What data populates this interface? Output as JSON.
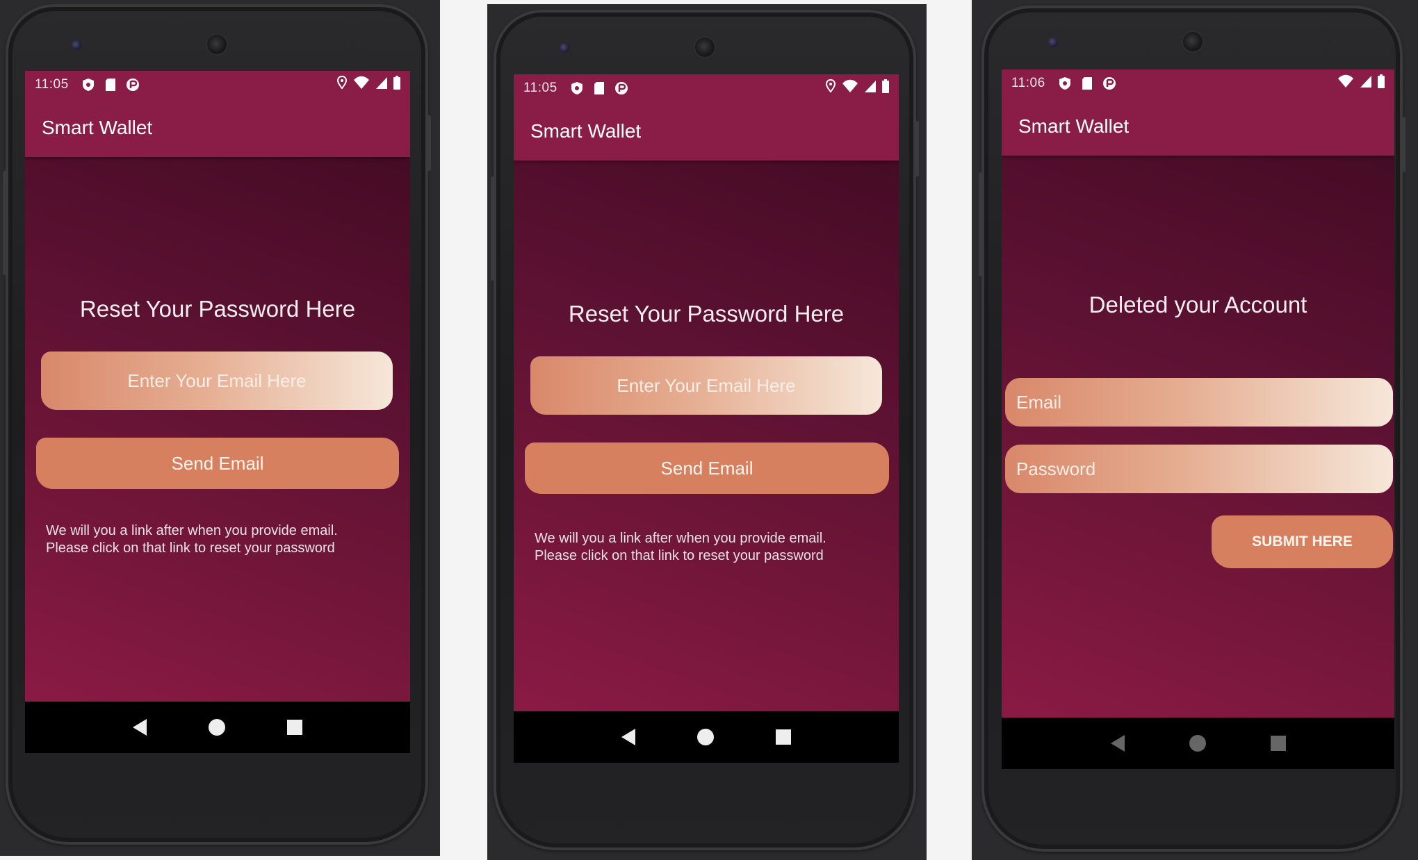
{
  "app": {
    "title": "Smart Wallet",
    "theme": {
      "primary": "#8a1d47",
      "background_top": "#450b25",
      "background_bottom": "#8a1a45",
      "accent": "#d6805f",
      "field_gradient_start": "#d9886a",
      "field_gradient_end": "#f6e7d9"
    }
  },
  "screens": [
    {
      "status": {
        "time": "11:05",
        "left_icons": [
          "shield-icon",
          "sd-card-icon",
          "notification-icon"
        ],
        "right_icons": [
          "location-icon",
          "wifi-icon",
          "signal-icon",
          "battery-icon"
        ]
      },
      "heading": "Reset Your Password Here",
      "email_placeholder": "Enter Your Email Here",
      "send_button": "Send Email",
      "note_line1": "We will you a link after when you provide email.",
      "note_line2": "Please click on that link to reset your password"
    },
    {
      "status": {
        "time": "11:05",
        "left_icons": [
          "shield-icon",
          "sd-card-icon",
          "notification-icon"
        ],
        "right_icons": [
          "location-icon",
          "wifi-icon",
          "signal-icon",
          "battery-icon"
        ]
      },
      "heading": "Reset Your Password Here",
      "email_placeholder": "Enter Your Email Here",
      "send_button": "Send Email",
      "note_line1": "We will you a link after when you provide email.",
      "note_line2": "Please click on that link to reset your password"
    },
    {
      "status": {
        "time": "11:06",
        "left_icons": [
          "shield-icon",
          "sd-card-icon",
          "notification-icon"
        ],
        "right_icons": [
          "wifi-icon",
          "signal-icon",
          "battery-icon"
        ]
      },
      "heading": "Deleted your Account",
      "email_label": "Email",
      "password_label": "Password",
      "submit_button": "SUBMIT HERE"
    }
  ],
  "nav": {
    "icons": [
      "back-icon",
      "home-icon",
      "recents-icon"
    ]
  }
}
